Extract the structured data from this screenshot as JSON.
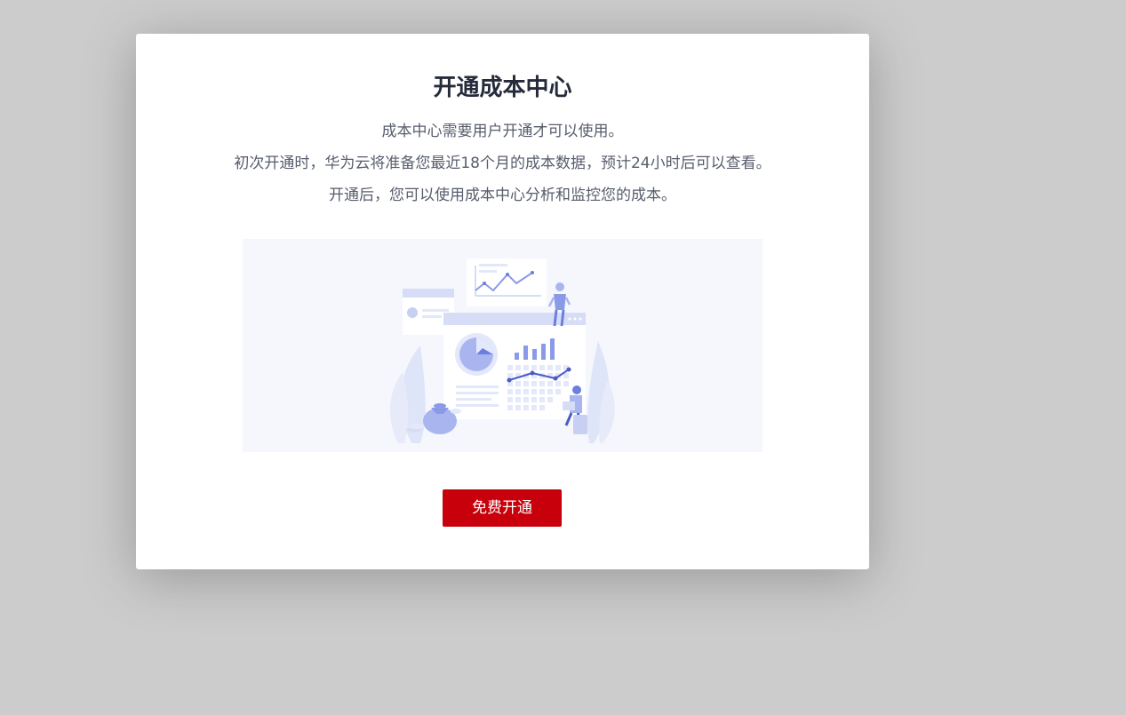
{
  "dialog": {
    "title": "开通成本中心",
    "lines": [
      "成本中心需要用户开通才可以使用。",
      "初次开通时，华为云将准备您最近18个月的成本数据，预计24小时后可以查看。",
      "开通后，您可以使用成本中心分析和监控您的成本。"
    ],
    "button_label": "免费开通",
    "illustration_icon": "cost-analysis-illustration"
  },
  "colors": {
    "overlay": "#cccccc",
    "primary_button": "#c7000b",
    "title_text": "#252b3a",
    "body_text": "#575d6c",
    "illustration_bg": "#f5f7fd",
    "illustration_accent": "#6b7fe0"
  }
}
